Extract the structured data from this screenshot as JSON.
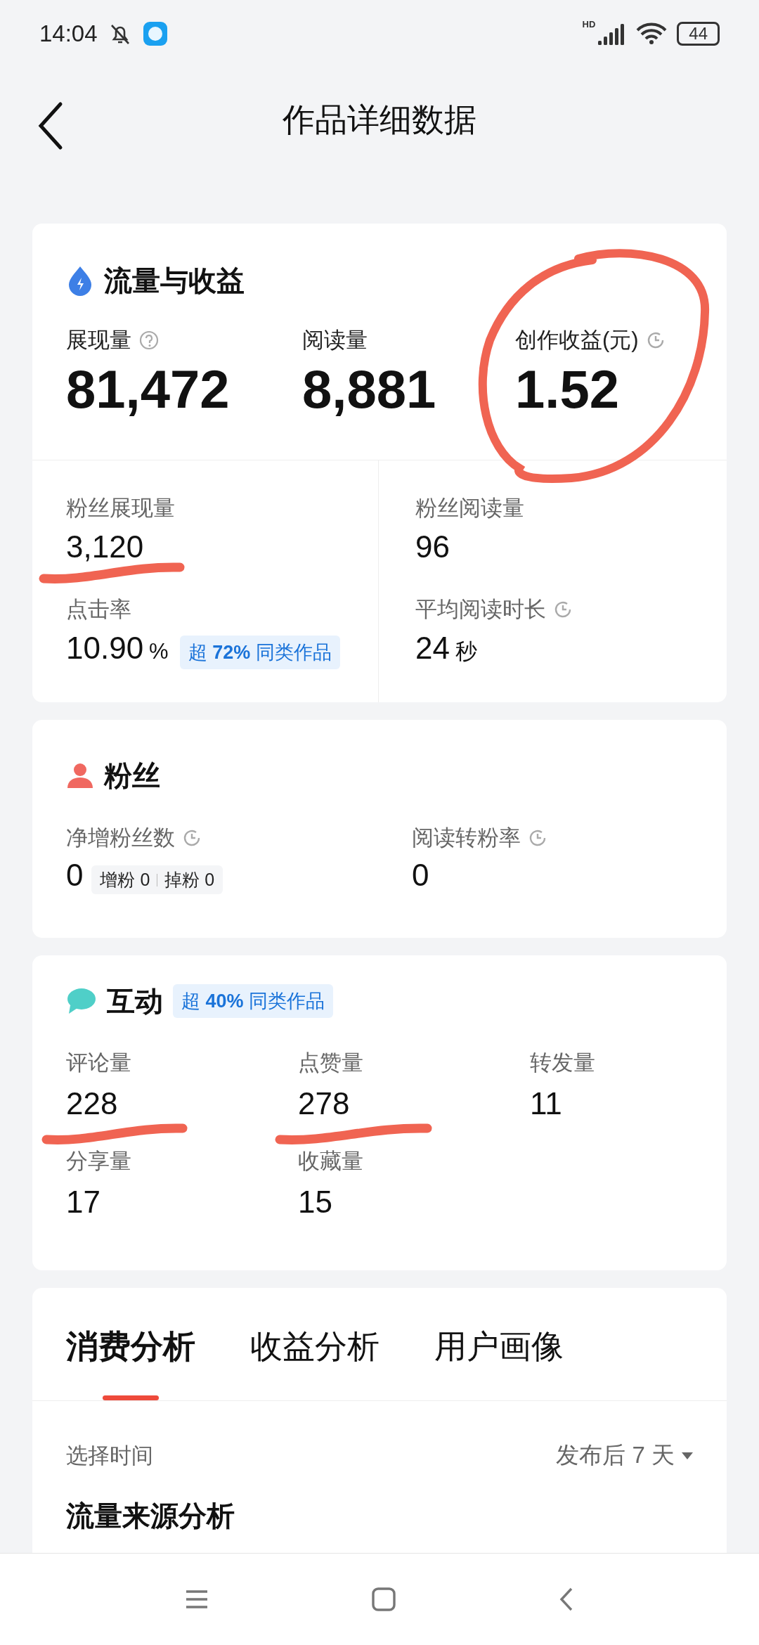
{
  "status_bar": {
    "time": "14:04",
    "network": "HD",
    "battery": "44"
  },
  "header": {
    "title": "作品详细数据"
  },
  "traffic": {
    "title": "流量与收益",
    "metrics": [
      {
        "label": "展现量",
        "value": "81,472",
        "help_icon": true
      },
      {
        "label": "阅读量",
        "value": "8,881"
      },
      {
        "label": "创作收益(元)",
        "value": "1.52",
        "clock_icon": true,
        "circled": true
      }
    ],
    "fan_metrics": [
      {
        "label": "粉丝展现量",
        "value": "3,120",
        "underlined": true
      },
      {
        "label": "粉丝阅读量",
        "value": "96"
      },
      {
        "label": "点击率",
        "value": "10.90",
        "unit": "%",
        "badge": "超 **72%** 同类作品"
      },
      {
        "label": "平均阅读时长",
        "value": "24",
        "unit": "秒",
        "clock_icon": true
      }
    ]
  },
  "fans": {
    "title": "粉丝",
    "metrics": [
      {
        "label": "净增粉丝数",
        "value": "0",
        "clock_icon": true,
        "breakdown": [
          {
            "label": "增粉",
            "value": "0"
          },
          {
            "label": "掉粉",
            "value": "0"
          }
        ]
      },
      {
        "label": "阅读转粉率",
        "value": "0",
        "clock_icon": true
      }
    ]
  },
  "interaction": {
    "title": "互动",
    "badge": "超 **40%** 同类作品",
    "metrics": [
      {
        "label": "评论量",
        "value": "228",
        "underlined": true
      },
      {
        "label": "点赞量",
        "value": "278",
        "underlined": true
      },
      {
        "label": "转发量",
        "value": "11"
      },
      {
        "label": "分享量",
        "value": "17"
      },
      {
        "label": "收藏量",
        "value": "15"
      }
    ]
  },
  "analysis": {
    "tabs": [
      {
        "label": "消费分析",
        "selected": true
      },
      {
        "label": "收益分析",
        "selected": false
      },
      {
        "label": "用户画像",
        "selected": false
      }
    ],
    "filter": {
      "label": "选择时间",
      "value": "发布后 7 天"
    },
    "section_heading": "流量来源分析"
  }
}
